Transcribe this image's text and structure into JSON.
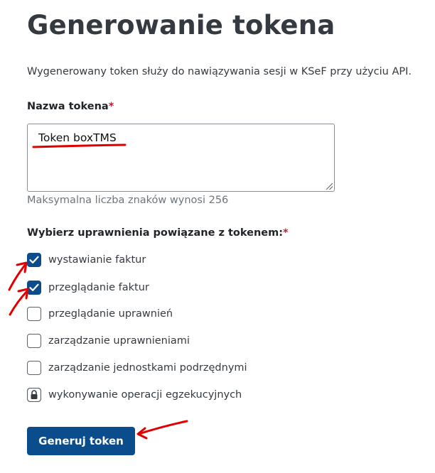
{
  "page": {
    "title": "Generowanie tokena",
    "description": "Wygenerowany token służy do nawiązywania sesji w KSeF przy użyciu API."
  },
  "token_name": {
    "label": "Nazwa tokena",
    "required_mark": "*",
    "value": "Token boxTMS",
    "hint": "Maksymalna liczba znaków wynosi 256"
  },
  "permissions": {
    "label": "Wybierz uprawnienia powiązane z tokenem:",
    "required_mark": "*",
    "items": [
      {
        "label": "wystawianie faktur",
        "state": "checked"
      },
      {
        "label": "przeglądanie faktur",
        "state": "checked"
      },
      {
        "label": "przeglądanie uprawnień",
        "state": "unchecked"
      },
      {
        "label": "zarządzanie uprawnieniami",
        "state": "unchecked"
      },
      {
        "label": "zarządzanie jednostkami podrzędnymi",
        "state": "unchecked"
      },
      {
        "label": "wykonywanie operacji egzekucyjnych",
        "state": "locked"
      }
    ]
  },
  "actions": {
    "generate_label": "Generuj token"
  },
  "colors": {
    "primary": "#0b4c8c",
    "required": "#c21c35",
    "annotation": "#e00000"
  }
}
